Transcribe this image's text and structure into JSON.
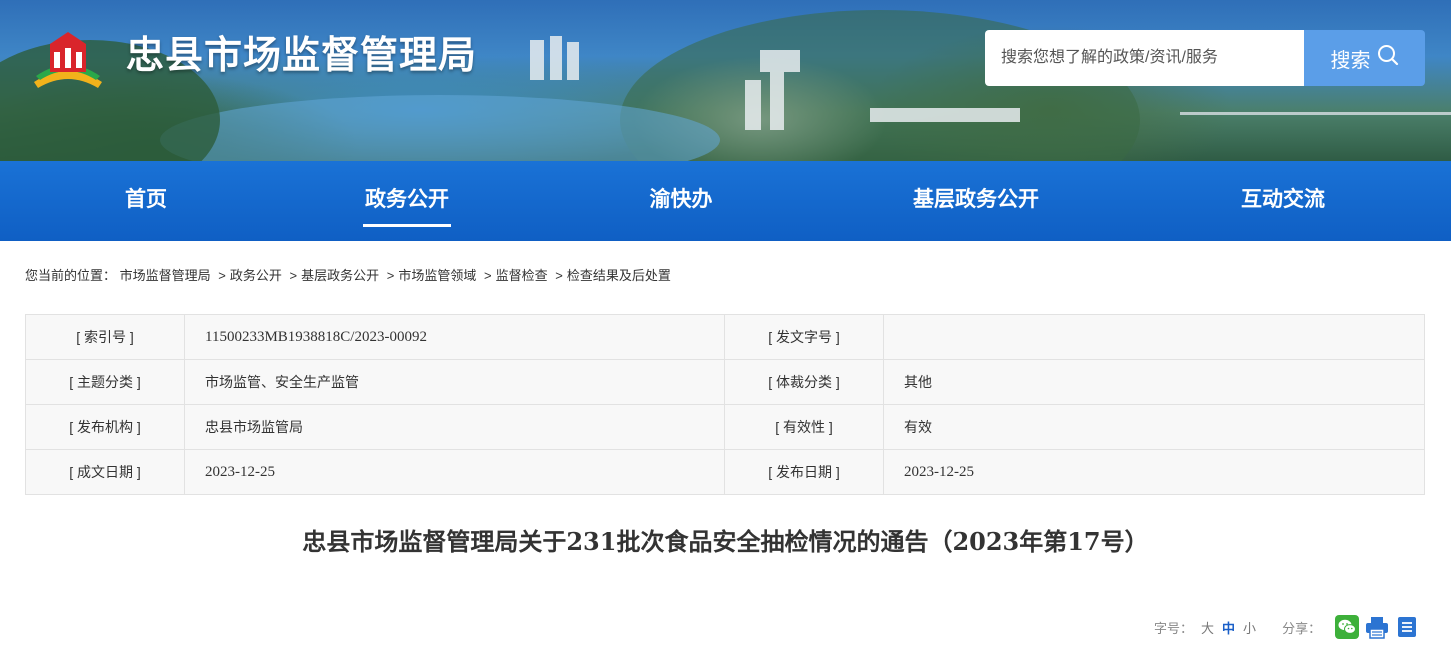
{
  "header": {
    "site_title": "忠县市场监督管理局",
    "search": {
      "placeholder": "搜索您想了解的政策/资讯/服务",
      "button_label": "搜索"
    }
  },
  "nav": {
    "items": [
      {
        "label": "首页",
        "active": false
      },
      {
        "label": "政务公开",
        "active": true
      },
      {
        "label": "渝快办",
        "active": false
      },
      {
        "label": "基层政务公开",
        "active": false
      },
      {
        "label": "互动交流",
        "active": false
      }
    ]
  },
  "breadcrumb": {
    "prefix": "您当前的位置：",
    "items": [
      "市场监督管理局",
      "政务公开",
      "基层政务公开",
      "市场监管领域",
      "监督检查",
      "检查结果及后处置"
    ],
    "separator": ">"
  },
  "meta": {
    "rows": [
      [
        {
          "key": "[ 索引号 ]",
          "value": "11500233MB1938818C/2023-00092"
        },
        {
          "key": "[ 发文字号 ]",
          "value": ""
        }
      ],
      [
        {
          "key": "[ 主题分类 ]",
          "value": "市场监管、安全生产监管"
        },
        {
          "key": "[ 体裁分类 ]",
          "value": "其他"
        }
      ],
      [
        {
          "key": "[ 发布机构 ]",
          "value": "忠县市场监管局"
        },
        {
          "key": "[ 有效性 ]",
          "value": "有效"
        }
      ],
      [
        {
          "key": "[ 成文日期 ]",
          "value": "2023-12-25"
        },
        {
          "key": "[ 发布日期 ]",
          "value": "2023-12-25"
        }
      ]
    ]
  },
  "article": {
    "title": "忠县市场监督管理局关于231批次食品安全抽检情况的通告（2023年第17号）"
  },
  "tools": {
    "font_size_label": "字号：",
    "font_sizes": [
      "大",
      "中",
      "小"
    ],
    "share_label": "分享：",
    "icons": [
      "wechat-icon",
      "print-icon",
      "doc-icon"
    ]
  },
  "colors": {
    "nav_bg": "#0f5fc4",
    "search_button": "#5b9ee8",
    "active_font_size": "#1a5fc8",
    "wechat": "#3db03a",
    "print": "#2c74d2"
  }
}
